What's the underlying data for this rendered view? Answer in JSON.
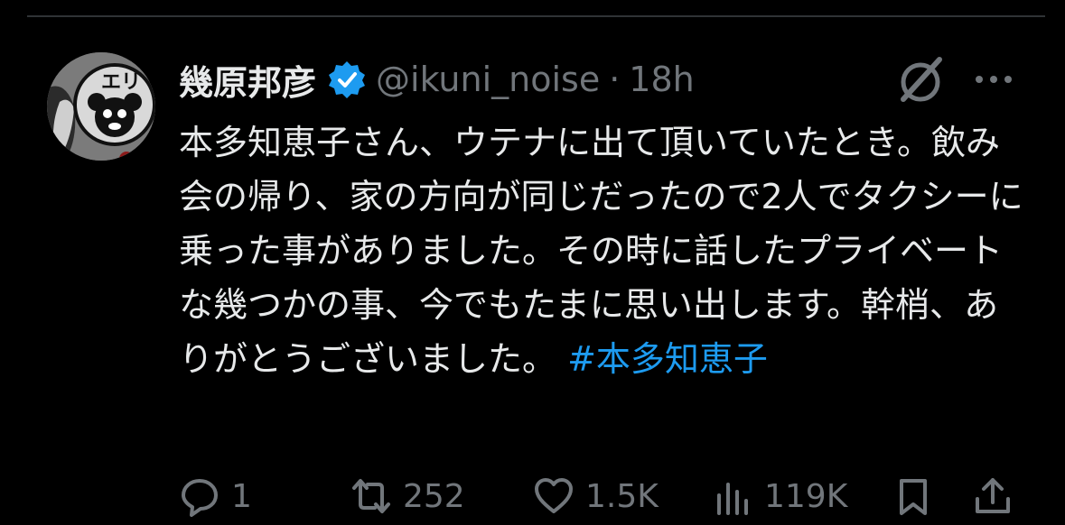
{
  "tweet": {
    "author": {
      "display_name": "幾原邦彦",
      "handle": "@ikuni_noise",
      "verified": true,
      "avatar_icon": "bear-badge-avatar"
    },
    "separator": "·",
    "time": "18h",
    "body": "本多知恵子さん、ウテナに出て頂いていたとき。飲み会の帰り、家の方向が同じだったので2人でタクシーに乗った事がありました。その時に話したプライベートな幾つかの事、今でもたまに思い出します。幹梢、ありがとうございました。 ",
    "hashtag": "#本多知恵子",
    "header_icons": [
      "grok-icon",
      "more-icon"
    ]
  },
  "actions": {
    "reply": {
      "icon": "reply-icon",
      "count": "1"
    },
    "repost": {
      "icon": "repost-icon",
      "count": "252"
    },
    "like": {
      "icon": "heart-icon",
      "count": "1.5K"
    },
    "views": {
      "icon": "views-icon",
      "count": "119K"
    },
    "bookmark": {
      "icon": "bookmark-icon"
    },
    "share": {
      "icon": "share-icon"
    }
  },
  "colors": {
    "background": "#000000",
    "text": "#e7e9ea",
    "secondary": "#71767b",
    "link": "#1d9bf0",
    "verified": "#1d9bf0",
    "divider": "#2f3336"
  }
}
